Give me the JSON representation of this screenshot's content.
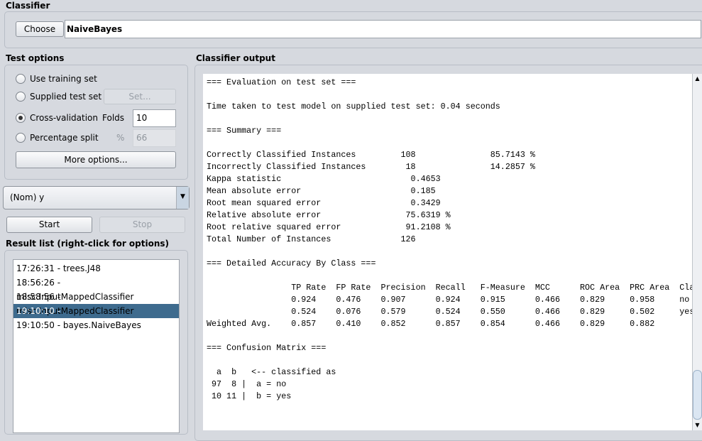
{
  "classifier": {
    "label": "Classifier",
    "choose_label": "Choose",
    "value": "NaiveBayes"
  },
  "test_options": {
    "label": "Test options",
    "use_training_set": "Use training set",
    "supplied_test_set": "Supplied test set",
    "set_button": "Set...",
    "cross_validation": "Cross-validation",
    "folds_label": "Folds",
    "folds_value": "10",
    "percentage_split": "Percentage split",
    "percent_label": "%",
    "percent_value": "66",
    "more_options": "More options...",
    "selected": "cross_validation"
  },
  "class_attribute": {
    "value": "(Nom) y"
  },
  "controls": {
    "start": "Start",
    "stop": "Stop"
  },
  "result_list": {
    "label": "Result list (right-click for options)",
    "items": [
      "17:26:31 - trees.J48",
      "18:56:26 - misc.InputMappedClassifier",
      "18:58:56 - misc.InputMappedClassifier",
      "19:10:10 - misc.InputMappedClassifier",
      "19:10:50 - bayes.NaiveBayes"
    ],
    "selected_index": 3
  },
  "output": {
    "label": "Classifier output",
    "lines": [
      "=== Evaluation on test set ===",
      "",
      "Time taken to test model on supplied test set: 0.04 seconds",
      "",
      "=== Summary ===",
      "",
      "Correctly Classified Instances         108               85.7143 %",
      "Incorrectly Classified Instances        18               14.2857 %",
      "Kappa statistic                          0.4653",
      "Mean absolute error                      0.185",
      "Root mean squared error                  0.3429",
      "Relative absolute error                 75.6319 %",
      "Root relative squared error             91.2108 %",
      "Total Number of Instances              126",
      "",
      "=== Detailed Accuracy By Class ===",
      "",
      "                 TP Rate  FP Rate  Precision  Recall   F-Measure  MCC      ROC Area  PRC Area  Class",
      "                 0.924    0.476    0.907      0.924    0.915      0.466    0.829     0.958     no",
      "                 0.524    0.076    0.579      0.524    0.550      0.466    0.829     0.502     yes",
      "Weighted Avg.    0.857    0.410    0.852      0.857    0.854      0.466    0.829     0.882",
      "",
      "=== Confusion Matrix ===",
      "",
      "  a  b   <-- classified as",
      " 97  8 |  a = no",
      " 10 11 |  b = yes"
    ]
  }
}
